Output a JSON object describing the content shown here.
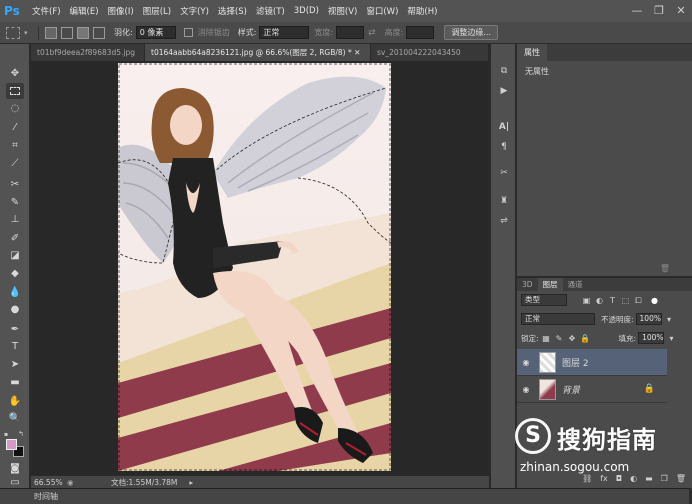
{
  "app": {
    "logo": "Ps"
  },
  "menu": [
    "文件(F)",
    "编辑(E)",
    "图像(I)",
    "图层(L)",
    "文字(Y)",
    "选择(S)",
    "滤镜(T)",
    "3D(D)",
    "视图(V)",
    "窗口(W)",
    "帮助(H)"
  ],
  "window_controls": {
    "minimize": "—",
    "restore": "❐",
    "close": "✕"
  },
  "options": {
    "feather_label": "羽化:",
    "feather_value": "0 像素",
    "antialias_label": "消除锯齿",
    "style_label": "样式:",
    "style_value": "正常",
    "width_label": "宽度:",
    "height_label": "高度:",
    "refine_edge_button": "调整边缘..."
  },
  "tabs": [
    {
      "label": "t01bf9deea2f89683d5.jpg"
    },
    {
      "label": "t0164aabb64a8236121.jpg @ 66.6%(图层 2, RGB/8) * ✕"
    },
    {
      "label": "sv_2010042220434​50"
    }
  ],
  "status": {
    "zoom": "66.55%",
    "doc_info": "文档:1.55M/3.78M"
  },
  "timeline": {
    "label": "时间轴"
  },
  "properties": {
    "tab_label": "属性",
    "content": "无属性"
  },
  "layers_panel": {
    "tabs": [
      "3D",
      "图层",
      "通道"
    ],
    "filter_value": "类型",
    "blend_mode": "正常",
    "opacity_label": "不透明度:",
    "opacity_value": "100%",
    "lock_label": "锁定:",
    "fill_label": "填充:",
    "fill_value": "100%",
    "layers": [
      {
        "name": "图层 2",
        "selected": true
      },
      {
        "name": "背景",
        "selected": false,
        "locked": true
      }
    ],
    "footer_icons": [
      "link-icon",
      "fx-icon",
      "mask-icon",
      "adjustment-icon",
      "folder-icon",
      "new-layer-icon",
      "trash-icon"
    ]
  },
  "watermark": {
    "logo": "S",
    "text": "搜狗指南",
    "url": "zhinan.sogou.com"
  },
  "colors": {
    "foreground": "#d49ac4",
    "background": "#111111",
    "selection": "#566278",
    "ps_blue": "#31a8ff"
  }
}
